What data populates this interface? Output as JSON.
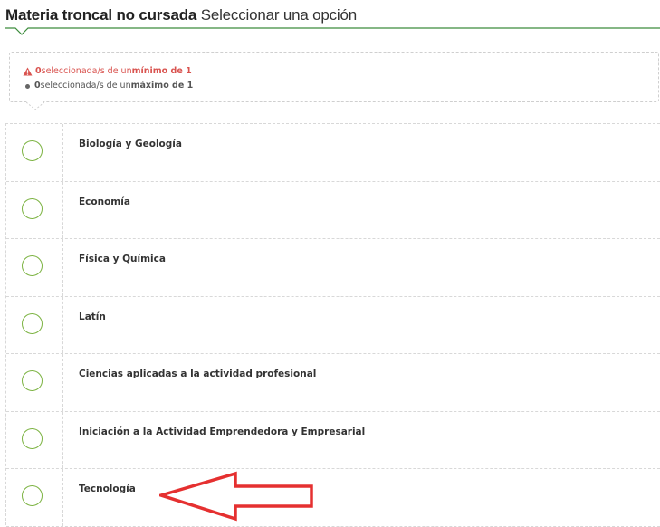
{
  "header": {
    "title_strong": "Materia troncal no cursada",
    "title_normal": "Seleccionar una opción",
    "accent_color": "#3c8c3c"
  },
  "selection_info": {
    "min": {
      "icon": "warning-icon",
      "count": "0",
      "text": " seleccionada/s de un ",
      "limit_label": "mínimo de 1",
      "color": "#d9534f"
    },
    "max": {
      "icon": "bullet-icon",
      "count": "0",
      "text": " seleccionada/s de un ",
      "limit_label": "máximo de 1",
      "color": "#555555"
    }
  },
  "options": [
    {
      "label": "Biología y Geología",
      "selected": false
    },
    {
      "label": "Economía",
      "selected": false
    },
    {
      "label": "Física y Química",
      "selected": false
    },
    {
      "label": "Latín",
      "selected": false
    },
    {
      "label": "Ciencias aplicadas a la actividad profesional",
      "selected": false
    },
    {
      "label": "Iniciación a la Actividad Emprendedora y Empresarial",
      "selected": false
    },
    {
      "label": "Tecnología",
      "selected": false
    }
  ],
  "annotation": {
    "type": "arrow-pointing-left",
    "color": "#e53030",
    "target_option": "Tecnología"
  }
}
